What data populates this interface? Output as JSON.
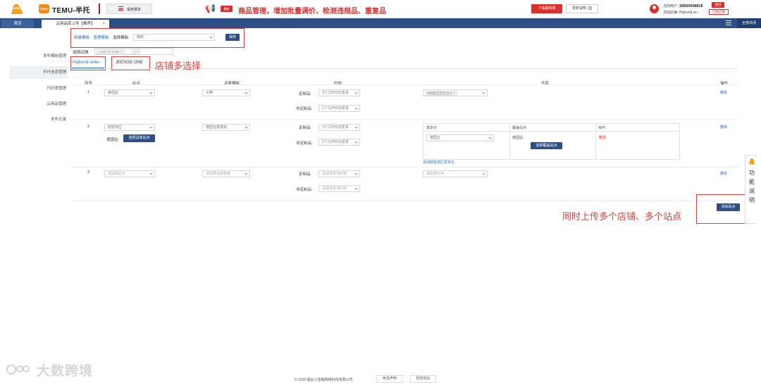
{
  "header": {
    "brand_badge": "TEMU",
    "brand_name": "TEMU-半托",
    "menu_label": "系统菜单",
    "announce_tag": "最新",
    "announce_text": "商品管理，增加批量调价、检测违规品、重复品",
    "download_label": "下载最新版",
    "update_label": "更新说明",
    "user_label": "当前用户:",
    "user_phone": "18560008818",
    "logout_label": "退出",
    "store_label": "当前店铺:",
    "store_name": "Highend se...",
    "switch_label": "切换店铺",
    "accent_color": "#d9302d"
  },
  "tabs": {
    "home": "首页",
    "active": "云商品库上传【推荐】",
    "close_all": "全部关闭"
  },
  "sidebar": {
    "items": [
      {
        "label": "发布模板管理"
      },
      {
        "label": "半托信息管理"
      },
      {
        "label": "尺码表管理"
      },
      {
        "label": "云商品管理"
      },
      {
        "label": "发布记录"
      }
    ]
  },
  "toolbar": {
    "new_template": "新建模板",
    "manage_template": "管理模板",
    "select_template_label": "选择模板:",
    "template_value": "微软",
    "save_label": "保存",
    "select_store_label": "选择店铺:",
    "store_chip": "Highend seller",
    "store_more": "+ 1"
  },
  "shop_tabs": [
    "Highend seller",
    "JEESOO ONE"
  ],
  "annotations": {
    "multi_store": "店铺多选择",
    "multi_upload": "同时上传多个店铺、多个站点"
  },
  "table": {
    "headers": {
      "index": "序号",
      "site": "站点",
      "shipping": "运费模板",
      "timeliness": "时效",
      "warehouse": "仓库",
      "action": "操作"
    },
    "rows": [
      {
        "index": "1",
        "site": "美国站",
        "shipping": "大腾",
        "custom_label": "定制品:",
        "custom_value": "3个工作日内发货",
        "noncustom_label": "非定制品:",
        "noncustom_value": "1个工作日内发货",
        "warehouse_chip": "闻福如自营店总仓",
        "delete": "删除"
      },
      {
        "index": "2",
        "site": "欧盟地区",
        "shipping": "德国运费模板",
        "sub_site_label": "德国站:",
        "select_site_btn": "选择具体站点",
        "custom_label": "定制品:",
        "custom_value": "3个工作日内发货",
        "noncustom_label": "非定制品:",
        "noncustom_value": "1个工作日内发货",
        "wh_header_source": "发货仓",
        "wh_header_cover": "覆盖站点",
        "wh_header_action": "操作",
        "wh_source_value": "德国仓",
        "wh_cover_value": "德国站",
        "wh_cover_btn": "选择覆盖站点",
        "wh_delete": "删除",
        "add_eu_warehouse": "添加欧盟地区发货仓",
        "delete": "删除"
      },
      {
        "index": "3",
        "site_placeholder": "请选择站点",
        "shipping_placeholder": "请选择运费模板",
        "custom_label": "定制品:",
        "custom_placeholder": "请选择发货时效",
        "noncustom_label": "非定制品:",
        "noncustom_placeholder": "请选择发货时效",
        "warehouse_placeholder": "请选择仓库",
        "delete": "删除"
      }
    ],
    "add_site_btn": "添加站点"
  },
  "float_panel": {
    "text": "功能说明"
  },
  "footer": {
    "copyright": "© 2024 烟台小蛮蝇网络科技有限公司",
    "disclaimer": "免责声明",
    "license": "授权协议"
  },
  "watermark": "大数跨境"
}
